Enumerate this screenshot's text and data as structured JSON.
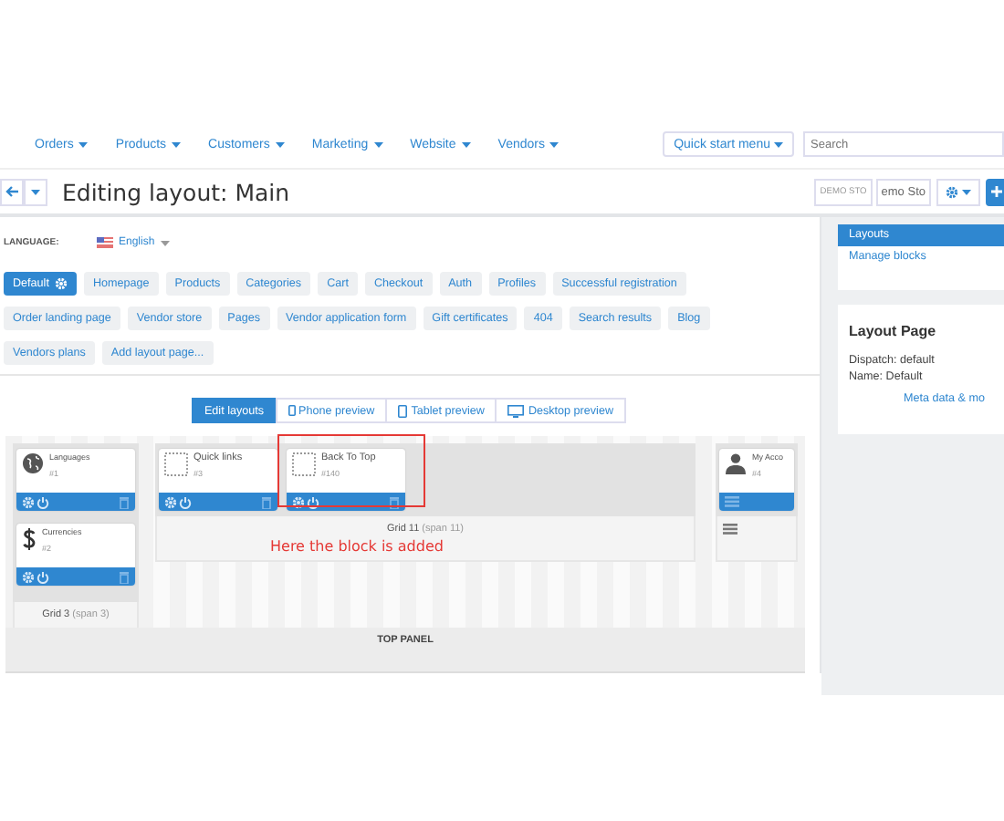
{
  "nav": {
    "items": [
      "Orders",
      "Products",
      "Customers",
      "Marketing",
      "Website",
      "Vendors"
    ],
    "quick_start": "Quick start menu",
    "search": {
      "placeholder": "Search"
    }
  },
  "header": {
    "title": "Editing layout: Main",
    "store_buttons": [
      "DEMO STO",
      "emo Sto"
    ]
  },
  "language": {
    "label": "LANGUAGE:",
    "value": "English"
  },
  "layout_tab_rows": [
    [
      {
        "label": "Default",
        "selected": true
      },
      {
        "label": "Homepage",
        "selected": false
      },
      {
        "label": "Products",
        "selected": false
      },
      {
        "label": "Categories",
        "selected": false
      },
      {
        "label": "Cart",
        "selected": false
      },
      {
        "label": "Checkout",
        "selected": false
      },
      {
        "label": "Auth",
        "selected": false
      },
      {
        "label": "Profiles",
        "selected": false
      },
      {
        "label": "Successful registration",
        "selected": false
      }
    ],
    [
      {
        "label": "Order landing page",
        "selected": false
      },
      {
        "label": "Vendor store",
        "selected": false
      },
      {
        "label": "Pages",
        "selected": false
      },
      {
        "label": "Vendor application form",
        "selected": false
      },
      {
        "label": "Gift certificates",
        "selected": false
      },
      {
        "label": "404",
        "selected": false
      },
      {
        "label": "Search results",
        "selected": false
      },
      {
        "label": "Blog",
        "selected": false
      }
    ],
    [
      {
        "label": "Vendors plans",
        "selected": false
      }
    ]
  ],
  "add_page_button": "Add layout page...",
  "preview_tabs": [
    {
      "label": "Edit layouts",
      "selected": true,
      "kind": "edit"
    },
    {
      "label": "Phone preview",
      "selected": false,
      "kind": "phone"
    },
    {
      "label": "Tablet preview",
      "selected": false,
      "kind": "tablet"
    },
    {
      "label": "Desktop preview",
      "selected": false,
      "kind": "desktop"
    }
  ],
  "grids": [
    {
      "title": "Grid 3",
      "span": "(span 3)",
      "blocks": [
        {
          "name": "Languages",
          "id": "#1",
          "kind": "globe",
          "highlighted": false
        },
        {
          "name": "Currencies",
          "id": "#2",
          "kind": "dollar",
          "highlighted": false
        }
      ]
    },
    {
      "title": "Grid 11",
      "span": "(span 11)",
      "note": "Here the block is added",
      "blocks": [
        {
          "name": "Quick links",
          "id": "#3",
          "kind": "empty",
          "highlighted": false
        },
        {
          "name": "Back To Top",
          "id": "#140",
          "kind": "empty",
          "highlighted": true
        }
      ]
    },
    {
      "blocks": [
        {
          "name": "My Acco",
          "id": "#4",
          "kind": "person",
          "highlighted": false
        }
      ]
    }
  ],
  "top_panel": "TOP PANEL",
  "sidebar": {
    "menu": [
      {
        "label": "Layouts",
        "selected": true
      },
      {
        "label": "Manage blocks",
        "selected": false
      }
    ],
    "info": {
      "title": "Layout Page",
      "lines": [
        "Dispatch: default",
        "Name: Default"
      ],
      "link": "Meta data & mo"
    }
  }
}
